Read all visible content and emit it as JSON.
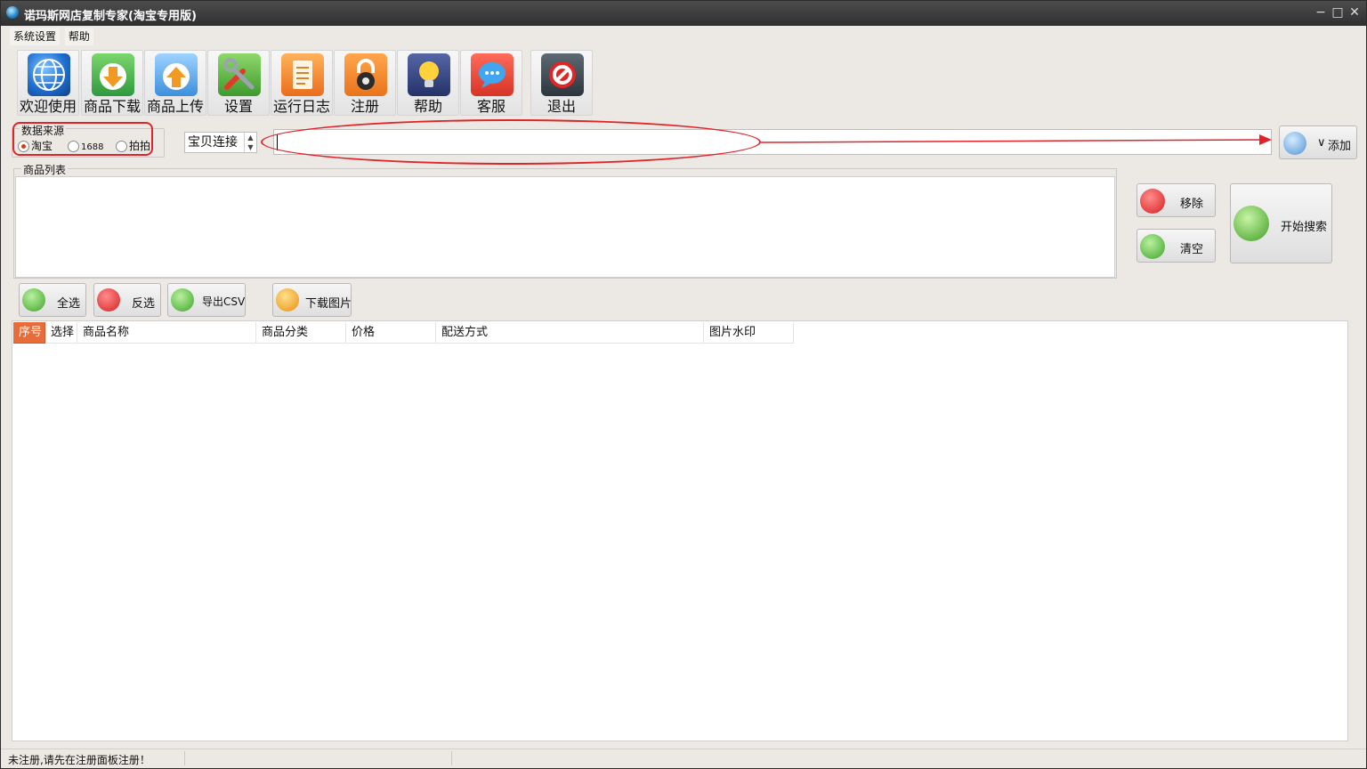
{
  "window": {
    "title": "诺玛斯网店复制专家(淘宝专用版)",
    "controls": {
      "minimize": "−",
      "maximize": "□",
      "close": "✕"
    }
  },
  "menubar": {
    "items": [
      "系统设置",
      "帮助"
    ]
  },
  "toolbar": {
    "items": [
      {
        "label": "欢迎使用",
        "icon": "globe-icon",
        "color": "#1f6fd0"
      },
      {
        "label": "商品下载",
        "icon": "download-icon",
        "color": "#3fae49"
      },
      {
        "label": "商品上传",
        "icon": "upload-icon",
        "color": "#4a9ee3"
      },
      {
        "label": "设置",
        "icon": "tools-icon",
        "color": "#5fa83c"
      },
      {
        "label": "运行日志",
        "icon": "log-icon",
        "color": "#ef7a22"
      },
      {
        "label": "注册",
        "icon": "lock-icon",
        "color": "#f08a1e"
      },
      {
        "label": "帮助",
        "icon": "lightbulb-icon",
        "color": "#3a4a8a"
      },
      {
        "label": "客服",
        "icon": "chat-icon",
        "color": "#e0443a"
      },
      {
        "label": "退出",
        "icon": "exit-icon",
        "color": "#d82a2a"
      }
    ]
  },
  "source": {
    "title": "数据来源",
    "options": [
      "淘宝",
      "1688",
      "拍拍"
    ],
    "selected": "淘宝"
  },
  "search": {
    "type_selected": "宝贝连接",
    "url_value": "",
    "add_label": "添加"
  },
  "product_list": {
    "title": "商品列表"
  },
  "side_buttons": {
    "remove": "移除",
    "clear": "清空",
    "start": "开始搜索"
  },
  "actions": {
    "select_all": "全选",
    "invert": "反选",
    "export_csv": "导出CSV",
    "download_images": "下载图片"
  },
  "grid": {
    "columns": [
      "序号",
      "选择",
      "商品名称",
      "商品分类",
      "价格",
      "配送方式",
      "图片水印"
    ],
    "rows": []
  },
  "status": {
    "text": "未注册,请先在注册面板注册！"
  },
  "colors": {
    "accent": "#e86b3a",
    "annotation_red": "#e0242a"
  }
}
